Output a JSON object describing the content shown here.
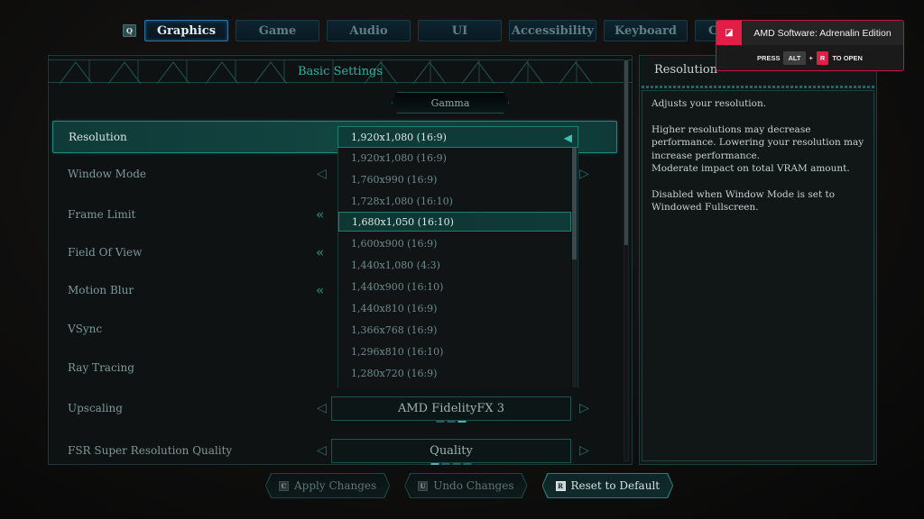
{
  "tabs": {
    "prev_key": "Q",
    "items": [
      {
        "label": "Graphics",
        "active": true
      },
      {
        "label": "Game",
        "active": false
      },
      {
        "label": "Audio",
        "active": false
      },
      {
        "label": "UI",
        "active": false
      },
      {
        "label": "Accessibility",
        "active": false
      },
      {
        "label": "Keyboard",
        "active": false
      },
      {
        "label": "C",
        "active": false
      }
    ]
  },
  "main": {
    "title": "Basic Settings",
    "gamma_label": "Gamma",
    "settings": [
      {
        "label": "Resolution",
        "value": "1,920x1,080 (16:9)"
      },
      {
        "label": "Window Mode"
      },
      {
        "label": "Frame Limit"
      },
      {
        "label": "Field Of View"
      },
      {
        "label": "Motion Blur"
      },
      {
        "label": "VSync"
      },
      {
        "label": "Ray Tracing"
      },
      {
        "label": "Upscaling",
        "value": "AMD FidelityFX 3",
        "page": 3,
        "pages": 3
      },
      {
        "label": "FSR Super Resolution Quality",
        "value": "Quality",
        "page": 1,
        "pages": 4
      }
    ]
  },
  "dropdown": {
    "current": "1,920x1,080 (16:9)",
    "highlighted_index": 3,
    "options": [
      "1,920x1,080 (16:9)",
      "1,760x990 (16:9)",
      "1,728x1,080 (16:10)",
      "1,680x1,050 (16:10)",
      "1,600x900 (16:9)",
      "1,440x1,080 (4:3)",
      "1,440x900 (16:10)",
      "1,440x810 (16:9)",
      "1,366x768 (16:9)",
      "1,296x810 (16:10)",
      "1,280x720 (16:9)"
    ]
  },
  "info": {
    "title": "Resolution",
    "lines": [
      "Adjusts your resolution.",
      "Higher resolutions may decrease performance. Lowering your resolution may increase performance.",
      "Moderate impact on total VRAM amount.",
      "Disabled when Window Mode is set to Windowed Fullscreen."
    ]
  },
  "amd_overlay": {
    "title": "AMD Software: Adrenalin Edition",
    "press": "PRESS",
    "key1": "ALT",
    "plus": "+",
    "key2": "R",
    "suffix": "TO OPEN",
    "accent": "#e01e46"
  },
  "footer": {
    "buttons": [
      {
        "key": "C",
        "label": "Apply Changes"
      },
      {
        "key": "U",
        "label": "Undo Changes"
      },
      {
        "key": "R",
        "label": "Reset to Default"
      }
    ]
  },
  "colors": {
    "accent_teal": "#2bb3a4",
    "tab_active_border": "#2f74a0",
    "amd_red": "#e01e46"
  }
}
